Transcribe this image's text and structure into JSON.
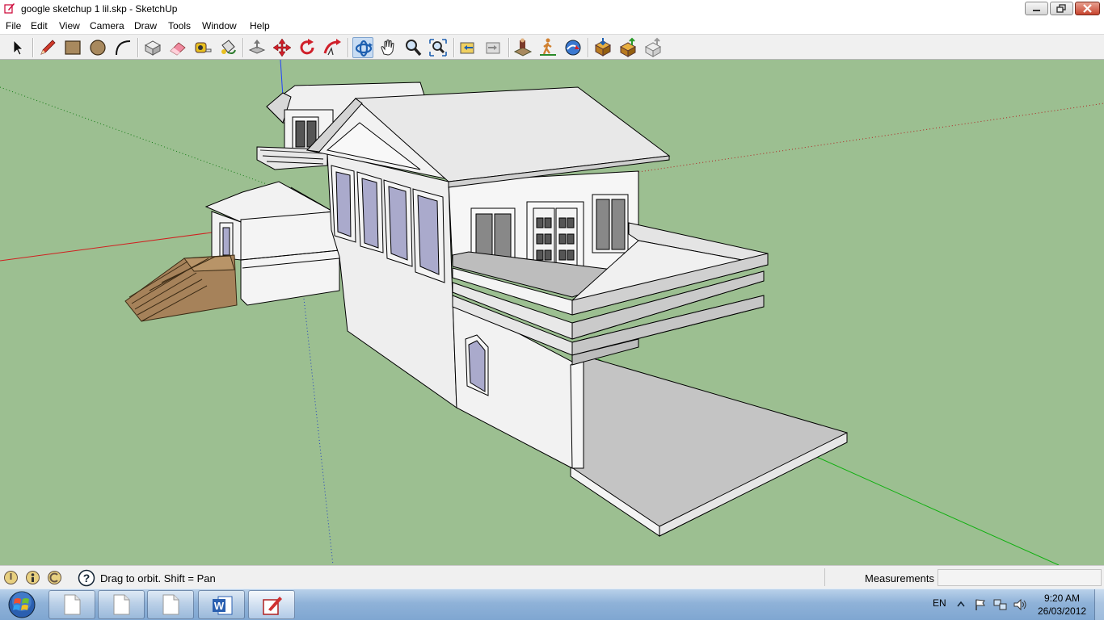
{
  "window": {
    "title": "google sketchup 1 lil.skp - SketchUp",
    "controls": [
      "minimize",
      "restore",
      "close"
    ]
  },
  "menu": {
    "items": [
      "File",
      "Edit",
      "View",
      "Camera",
      "Draw",
      "Tools",
      "Window",
      "Help"
    ]
  },
  "toolbar": {
    "tools": [
      {
        "name": "select-tool-button",
        "icon": "arrow-cursor-icon"
      },
      {
        "name": "pencil-tool-button",
        "icon": "pencil-icon"
      },
      {
        "name": "rectangle-tool-button",
        "icon": "rectangle-icon"
      },
      {
        "name": "circle-tool-button",
        "icon": "circle-icon"
      },
      {
        "name": "arc-tool-button",
        "icon": "arc-icon"
      },
      {
        "name": "make-component-button",
        "icon": "component-box-icon"
      },
      {
        "name": "eraser-tool-button",
        "icon": "eraser-icon"
      },
      {
        "name": "tape-measure-button",
        "icon": "tape-measure-icon"
      },
      {
        "name": "paint-bucket-button",
        "icon": "paint-bucket-icon"
      },
      {
        "name": "push-pull-button",
        "icon": "push-pull-icon"
      },
      {
        "name": "move-tool-button",
        "icon": "move-arrows-icon"
      },
      {
        "name": "rotate-tool-button",
        "icon": "rotate-icon"
      },
      {
        "name": "follow-me-button",
        "icon": "follow-me-icon"
      },
      {
        "name": "orbit-tool-button",
        "icon": "orbit-icon",
        "active": true
      },
      {
        "name": "pan-tool-button",
        "icon": "hand-icon"
      },
      {
        "name": "zoom-tool-button",
        "icon": "magnifier-icon"
      },
      {
        "name": "zoom-extents-button",
        "icon": "zoom-extents-icon"
      },
      {
        "name": "previous-view-button",
        "icon": "previous-view-icon"
      },
      {
        "name": "next-view-button",
        "icon": "next-view-icon"
      },
      {
        "name": "position-camera-button",
        "icon": "position-camera-icon"
      },
      {
        "name": "walk-tool-button",
        "icon": "walk-icon"
      },
      {
        "name": "look-around-button",
        "icon": "look-around-icon"
      },
      {
        "name": "get-models-button",
        "icon": "get-models-icon"
      },
      {
        "name": "share-model-button",
        "icon": "share-model-icon"
      },
      {
        "name": "share-component-button",
        "icon": "share-component-icon"
      }
    ]
  },
  "status": {
    "hint": "Drag to orbit.  Shift = Pan",
    "measurements_label": "Measurements",
    "measurements_value": ""
  },
  "taskbar": {
    "language": "EN",
    "time": "9:20 AM",
    "date": "26/03/2012"
  },
  "colors": {
    "ground": "#9cbf91",
    "wall": "#f2f2f2",
    "wall_shade": "#e2e2e2",
    "slab": "#c8c8c8",
    "window_glass": "#aaaacc",
    "stairs": "#a6825a",
    "axis_red": "#d02020",
    "axis_green": "#10b010",
    "axis_blue": "#2040ff"
  }
}
